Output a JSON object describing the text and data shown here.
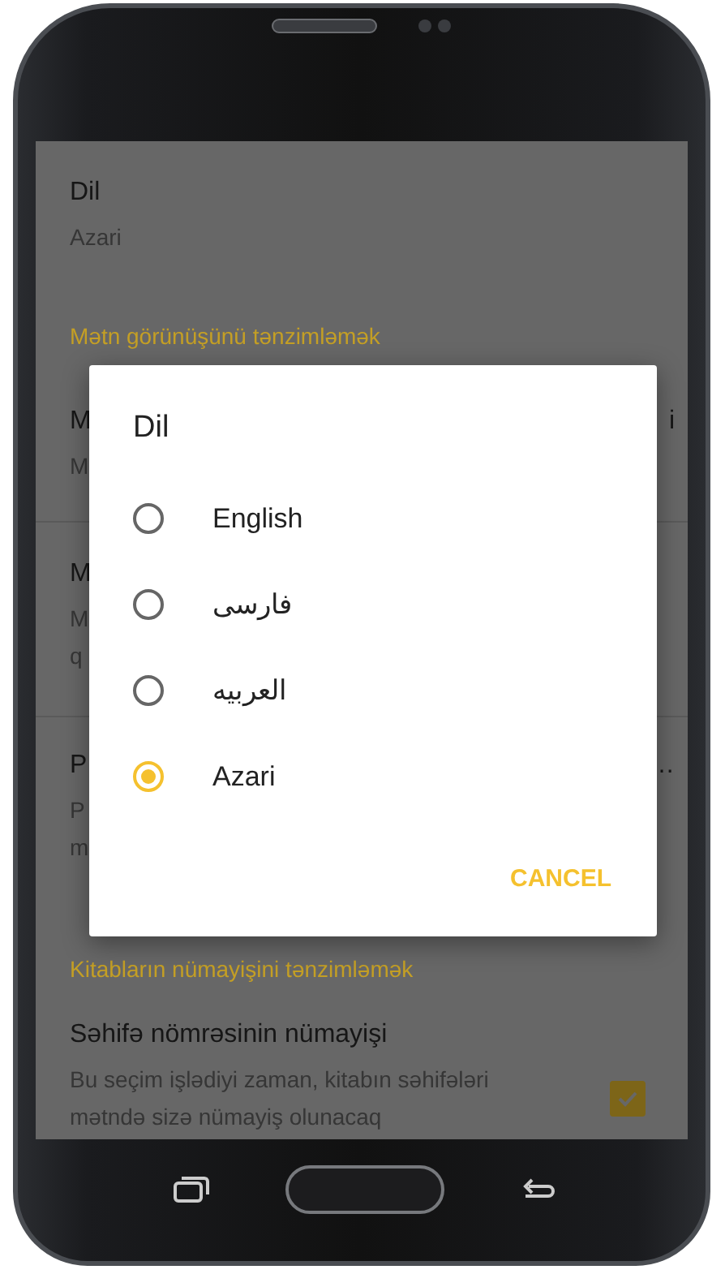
{
  "settings": [
    {
      "kind": "item",
      "title": "Dil",
      "subtitle": "Azari"
    },
    {
      "kind": "header",
      "title": "Mətn görünüşünü tənzimləmək"
    },
    {
      "kind": "partial",
      "title_start": "M",
      "title_end": "i",
      "lines": [
        "M"
      ]
    },
    {
      "kind": "partial",
      "title_start": "M",
      "lines": [
        "M",
        "q"
      ]
    },
    {
      "kind": "partial",
      "title_start": "P",
      "title_end": "…",
      "lines": [
        "P",
        "m"
      ]
    },
    {
      "kind": "header",
      "title": "Kitabların nümayişini tənzimləmək"
    },
    {
      "kind": "check",
      "title": "Səhifə nömrəsinin nümayişi",
      "subtitle": "Bu seçim işlədiyi zaman, kitabın səhifələri mətndə sizə nümayiş olunacaq",
      "checked": true
    }
  ],
  "dialog": {
    "title": "Dil",
    "options": [
      {
        "label": "English",
        "selected": false
      },
      {
        "label": "فارسی",
        "selected": false
      },
      {
        "label": "العربیه",
        "selected": false
      },
      {
        "label": "Azari",
        "selected": true
      }
    ],
    "cancel": "CANCEL"
  }
}
